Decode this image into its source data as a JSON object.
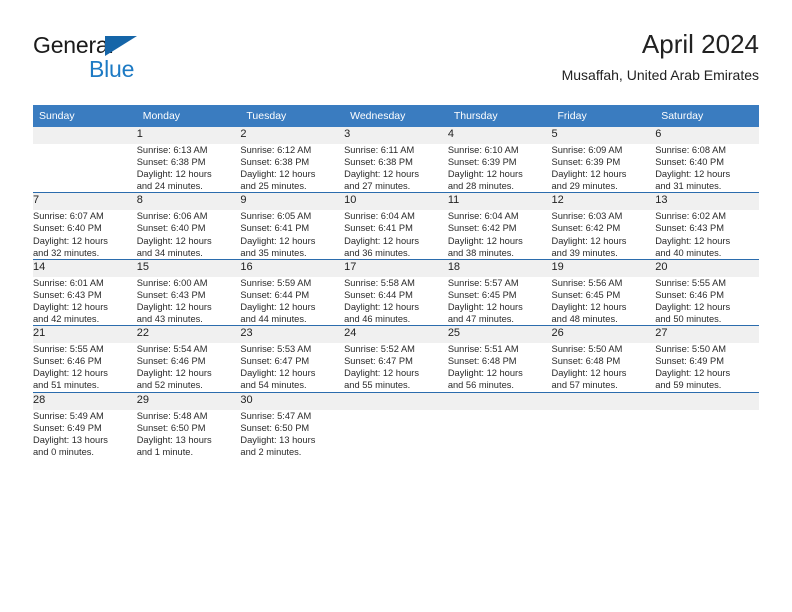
{
  "brand": {
    "name_part1": "General",
    "name_part2": "Blue",
    "accent_color": "#1d7ac4",
    "triangle_color": "#1565a8"
  },
  "header": {
    "title": "April 2024",
    "subtitle": "Musaffah, United Arab Emirates"
  },
  "theme": {
    "header_row_bg": "#3a7cc0",
    "day_number_bg": "#f0f0f0",
    "week_separator": "#2b6cad"
  },
  "weekday_headers": [
    "Sunday",
    "Monday",
    "Tuesday",
    "Wednesday",
    "Thursday",
    "Friday",
    "Saturday"
  ],
  "weeks": [
    [
      {
        "day": "",
        "sunrise": "",
        "sunset": "",
        "daylight1": "",
        "daylight2": ""
      },
      {
        "day": "1",
        "sunrise": "Sunrise: 6:13 AM",
        "sunset": "Sunset: 6:38 PM",
        "daylight1": "Daylight: 12 hours",
        "daylight2": "and 24 minutes."
      },
      {
        "day": "2",
        "sunrise": "Sunrise: 6:12 AM",
        "sunset": "Sunset: 6:38 PM",
        "daylight1": "Daylight: 12 hours",
        "daylight2": "and 25 minutes."
      },
      {
        "day": "3",
        "sunrise": "Sunrise: 6:11 AM",
        "sunset": "Sunset: 6:38 PM",
        "daylight1": "Daylight: 12 hours",
        "daylight2": "and 27 minutes."
      },
      {
        "day": "4",
        "sunrise": "Sunrise: 6:10 AM",
        "sunset": "Sunset: 6:39 PM",
        "daylight1": "Daylight: 12 hours",
        "daylight2": "and 28 minutes."
      },
      {
        "day": "5",
        "sunrise": "Sunrise: 6:09 AM",
        "sunset": "Sunset: 6:39 PM",
        "daylight1": "Daylight: 12 hours",
        "daylight2": "and 29 minutes."
      },
      {
        "day": "6",
        "sunrise": "Sunrise: 6:08 AM",
        "sunset": "Sunset: 6:40 PM",
        "daylight1": "Daylight: 12 hours",
        "daylight2": "and 31 minutes."
      }
    ],
    [
      {
        "day": "7",
        "sunrise": "Sunrise: 6:07 AM",
        "sunset": "Sunset: 6:40 PM",
        "daylight1": "Daylight: 12 hours",
        "daylight2": "and 32 minutes."
      },
      {
        "day": "8",
        "sunrise": "Sunrise: 6:06 AM",
        "sunset": "Sunset: 6:40 PM",
        "daylight1": "Daylight: 12 hours",
        "daylight2": "and 34 minutes."
      },
      {
        "day": "9",
        "sunrise": "Sunrise: 6:05 AM",
        "sunset": "Sunset: 6:41 PM",
        "daylight1": "Daylight: 12 hours",
        "daylight2": "and 35 minutes."
      },
      {
        "day": "10",
        "sunrise": "Sunrise: 6:04 AM",
        "sunset": "Sunset: 6:41 PM",
        "daylight1": "Daylight: 12 hours",
        "daylight2": "and 36 minutes."
      },
      {
        "day": "11",
        "sunrise": "Sunrise: 6:04 AM",
        "sunset": "Sunset: 6:42 PM",
        "daylight1": "Daylight: 12 hours",
        "daylight2": "and 38 minutes."
      },
      {
        "day": "12",
        "sunrise": "Sunrise: 6:03 AM",
        "sunset": "Sunset: 6:42 PM",
        "daylight1": "Daylight: 12 hours",
        "daylight2": "and 39 minutes."
      },
      {
        "day": "13",
        "sunrise": "Sunrise: 6:02 AM",
        "sunset": "Sunset: 6:43 PM",
        "daylight1": "Daylight: 12 hours",
        "daylight2": "and 40 minutes."
      }
    ],
    [
      {
        "day": "14",
        "sunrise": "Sunrise: 6:01 AM",
        "sunset": "Sunset: 6:43 PM",
        "daylight1": "Daylight: 12 hours",
        "daylight2": "and 42 minutes."
      },
      {
        "day": "15",
        "sunrise": "Sunrise: 6:00 AM",
        "sunset": "Sunset: 6:43 PM",
        "daylight1": "Daylight: 12 hours",
        "daylight2": "and 43 minutes."
      },
      {
        "day": "16",
        "sunrise": "Sunrise: 5:59 AM",
        "sunset": "Sunset: 6:44 PM",
        "daylight1": "Daylight: 12 hours",
        "daylight2": "and 44 minutes."
      },
      {
        "day": "17",
        "sunrise": "Sunrise: 5:58 AM",
        "sunset": "Sunset: 6:44 PM",
        "daylight1": "Daylight: 12 hours",
        "daylight2": "and 46 minutes."
      },
      {
        "day": "18",
        "sunrise": "Sunrise: 5:57 AM",
        "sunset": "Sunset: 6:45 PM",
        "daylight1": "Daylight: 12 hours",
        "daylight2": "and 47 minutes."
      },
      {
        "day": "19",
        "sunrise": "Sunrise: 5:56 AM",
        "sunset": "Sunset: 6:45 PM",
        "daylight1": "Daylight: 12 hours",
        "daylight2": "and 48 minutes."
      },
      {
        "day": "20",
        "sunrise": "Sunrise: 5:55 AM",
        "sunset": "Sunset: 6:46 PM",
        "daylight1": "Daylight: 12 hours",
        "daylight2": "and 50 minutes."
      }
    ],
    [
      {
        "day": "21",
        "sunrise": "Sunrise: 5:55 AM",
        "sunset": "Sunset: 6:46 PM",
        "daylight1": "Daylight: 12 hours",
        "daylight2": "and 51 minutes."
      },
      {
        "day": "22",
        "sunrise": "Sunrise: 5:54 AM",
        "sunset": "Sunset: 6:46 PM",
        "daylight1": "Daylight: 12 hours",
        "daylight2": "and 52 minutes."
      },
      {
        "day": "23",
        "sunrise": "Sunrise: 5:53 AM",
        "sunset": "Sunset: 6:47 PM",
        "daylight1": "Daylight: 12 hours",
        "daylight2": "and 54 minutes."
      },
      {
        "day": "24",
        "sunrise": "Sunrise: 5:52 AM",
        "sunset": "Sunset: 6:47 PM",
        "daylight1": "Daylight: 12 hours",
        "daylight2": "and 55 minutes."
      },
      {
        "day": "25",
        "sunrise": "Sunrise: 5:51 AM",
        "sunset": "Sunset: 6:48 PM",
        "daylight1": "Daylight: 12 hours",
        "daylight2": "and 56 minutes."
      },
      {
        "day": "26",
        "sunrise": "Sunrise: 5:50 AM",
        "sunset": "Sunset: 6:48 PM",
        "daylight1": "Daylight: 12 hours",
        "daylight2": "and 57 minutes."
      },
      {
        "day": "27",
        "sunrise": "Sunrise: 5:50 AM",
        "sunset": "Sunset: 6:49 PM",
        "daylight1": "Daylight: 12 hours",
        "daylight2": "and 59 minutes."
      }
    ],
    [
      {
        "day": "28",
        "sunrise": "Sunrise: 5:49 AM",
        "sunset": "Sunset: 6:49 PM",
        "daylight1": "Daylight: 13 hours",
        "daylight2": "and 0 minutes."
      },
      {
        "day": "29",
        "sunrise": "Sunrise: 5:48 AM",
        "sunset": "Sunset: 6:50 PM",
        "daylight1": "Daylight: 13 hours",
        "daylight2": "and 1 minute."
      },
      {
        "day": "30",
        "sunrise": "Sunrise: 5:47 AM",
        "sunset": "Sunset: 6:50 PM",
        "daylight1": "Daylight: 13 hours",
        "daylight2": "and 2 minutes."
      },
      {
        "day": "",
        "sunrise": "",
        "sunset": "",
        "daylight1": "",
        "daylight2": ""
      },
      {
        "day": "",
        "sunrise": "",
        "sunset": "",
        "daylight1": "",
        "daylight2": ""
      },
      {
        "day": "",
        "sunrise": "",
        "sunset": "",
        "daylight1": "",
        "daylight2": ""
      },
      {
        "day": "",
        "sunrise": "",
        "sunset": "",
        "daylight1": "",
        "daylight2": ""
      }
    ]
  ]
}
